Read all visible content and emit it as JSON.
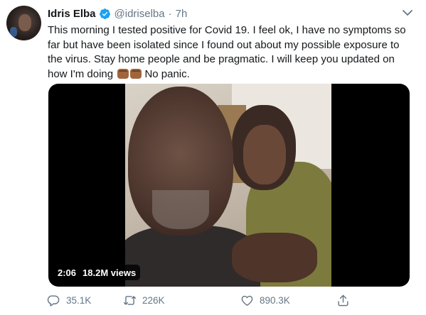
{
  "tweet": {
    "author_name": "Idris Elba",
    "handle": "@idriselba",
    "separator": "·",
    "time_ago": "7h",
    "text_lines": [
      "This morning I tested positive for Covid 19. I feel ok, I have no symptoms so",
      "far but have been isolated since I found out about my possible exposure to",
      "the virus.  Stay home people and be pragmatic. I will keep you updated on",
      "how I'm doing"
    ],
    "text_tail": "No panic.",
    "emoji": [
      "fist-bump-emoji",
      "fist-bump-emoji"
    ]
  },
  "media": {
    "duration": "2:06",
    "views": "18.2M views"
  },
  "actions": {
    "reply_count": "35.1K",
    "retweet_count": "226K",
    "like_count": "890.3K"
  },
  "colors": {
    "text": "#14171a",
    "muted": "#657786",
    "verified": "#1da1f2"
  }
}
